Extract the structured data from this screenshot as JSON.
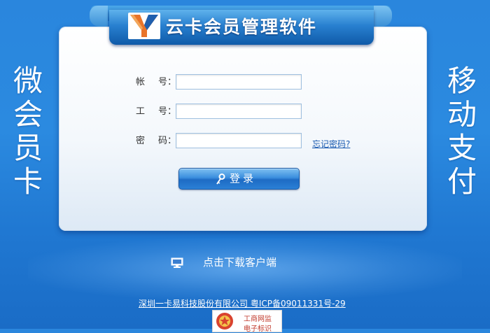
{
  "header": {
    "title": "云卡会员管理软件"
  },
  "side": {
    "left": [
      "微",
      "会",
      "员",
      "卡"
    ],
    "right": [
      "移",
      "动",
      "支",
      "付"
    ]
  },
  "form": {
    "account": {
      "label_a": "帐",
      "label_b": "号：",
      "value": ""
    },
    "staff": {
      "label_a": "工",
      "label_b": "号：",
      "value": ""
    },
    "password": {
      "label_a": "密",
      "label_b": "码：",
      "value": ""
    },
    "forgot_link": "忘记密码?",
    "login_label": "登录",
    "login_icon": "key-icon"
  },
  "download": {
    "label": "点击下载客户端",
    "icon": "computer-icon"
  },
  "footer": {
    "company": "深圳一卡易科技股份有限公司",
    "icp": "粤ICP备09011331号-29",
    "badge_line1": "工商网监",
    "badge_line2": "电子标识"
  },
  "colors": {
    "background": "#2b8ae0",
    "title_bar": "#2880d0",
    "button": "#3a8ede",
    "link": "#1a5ab0"
  }
}
